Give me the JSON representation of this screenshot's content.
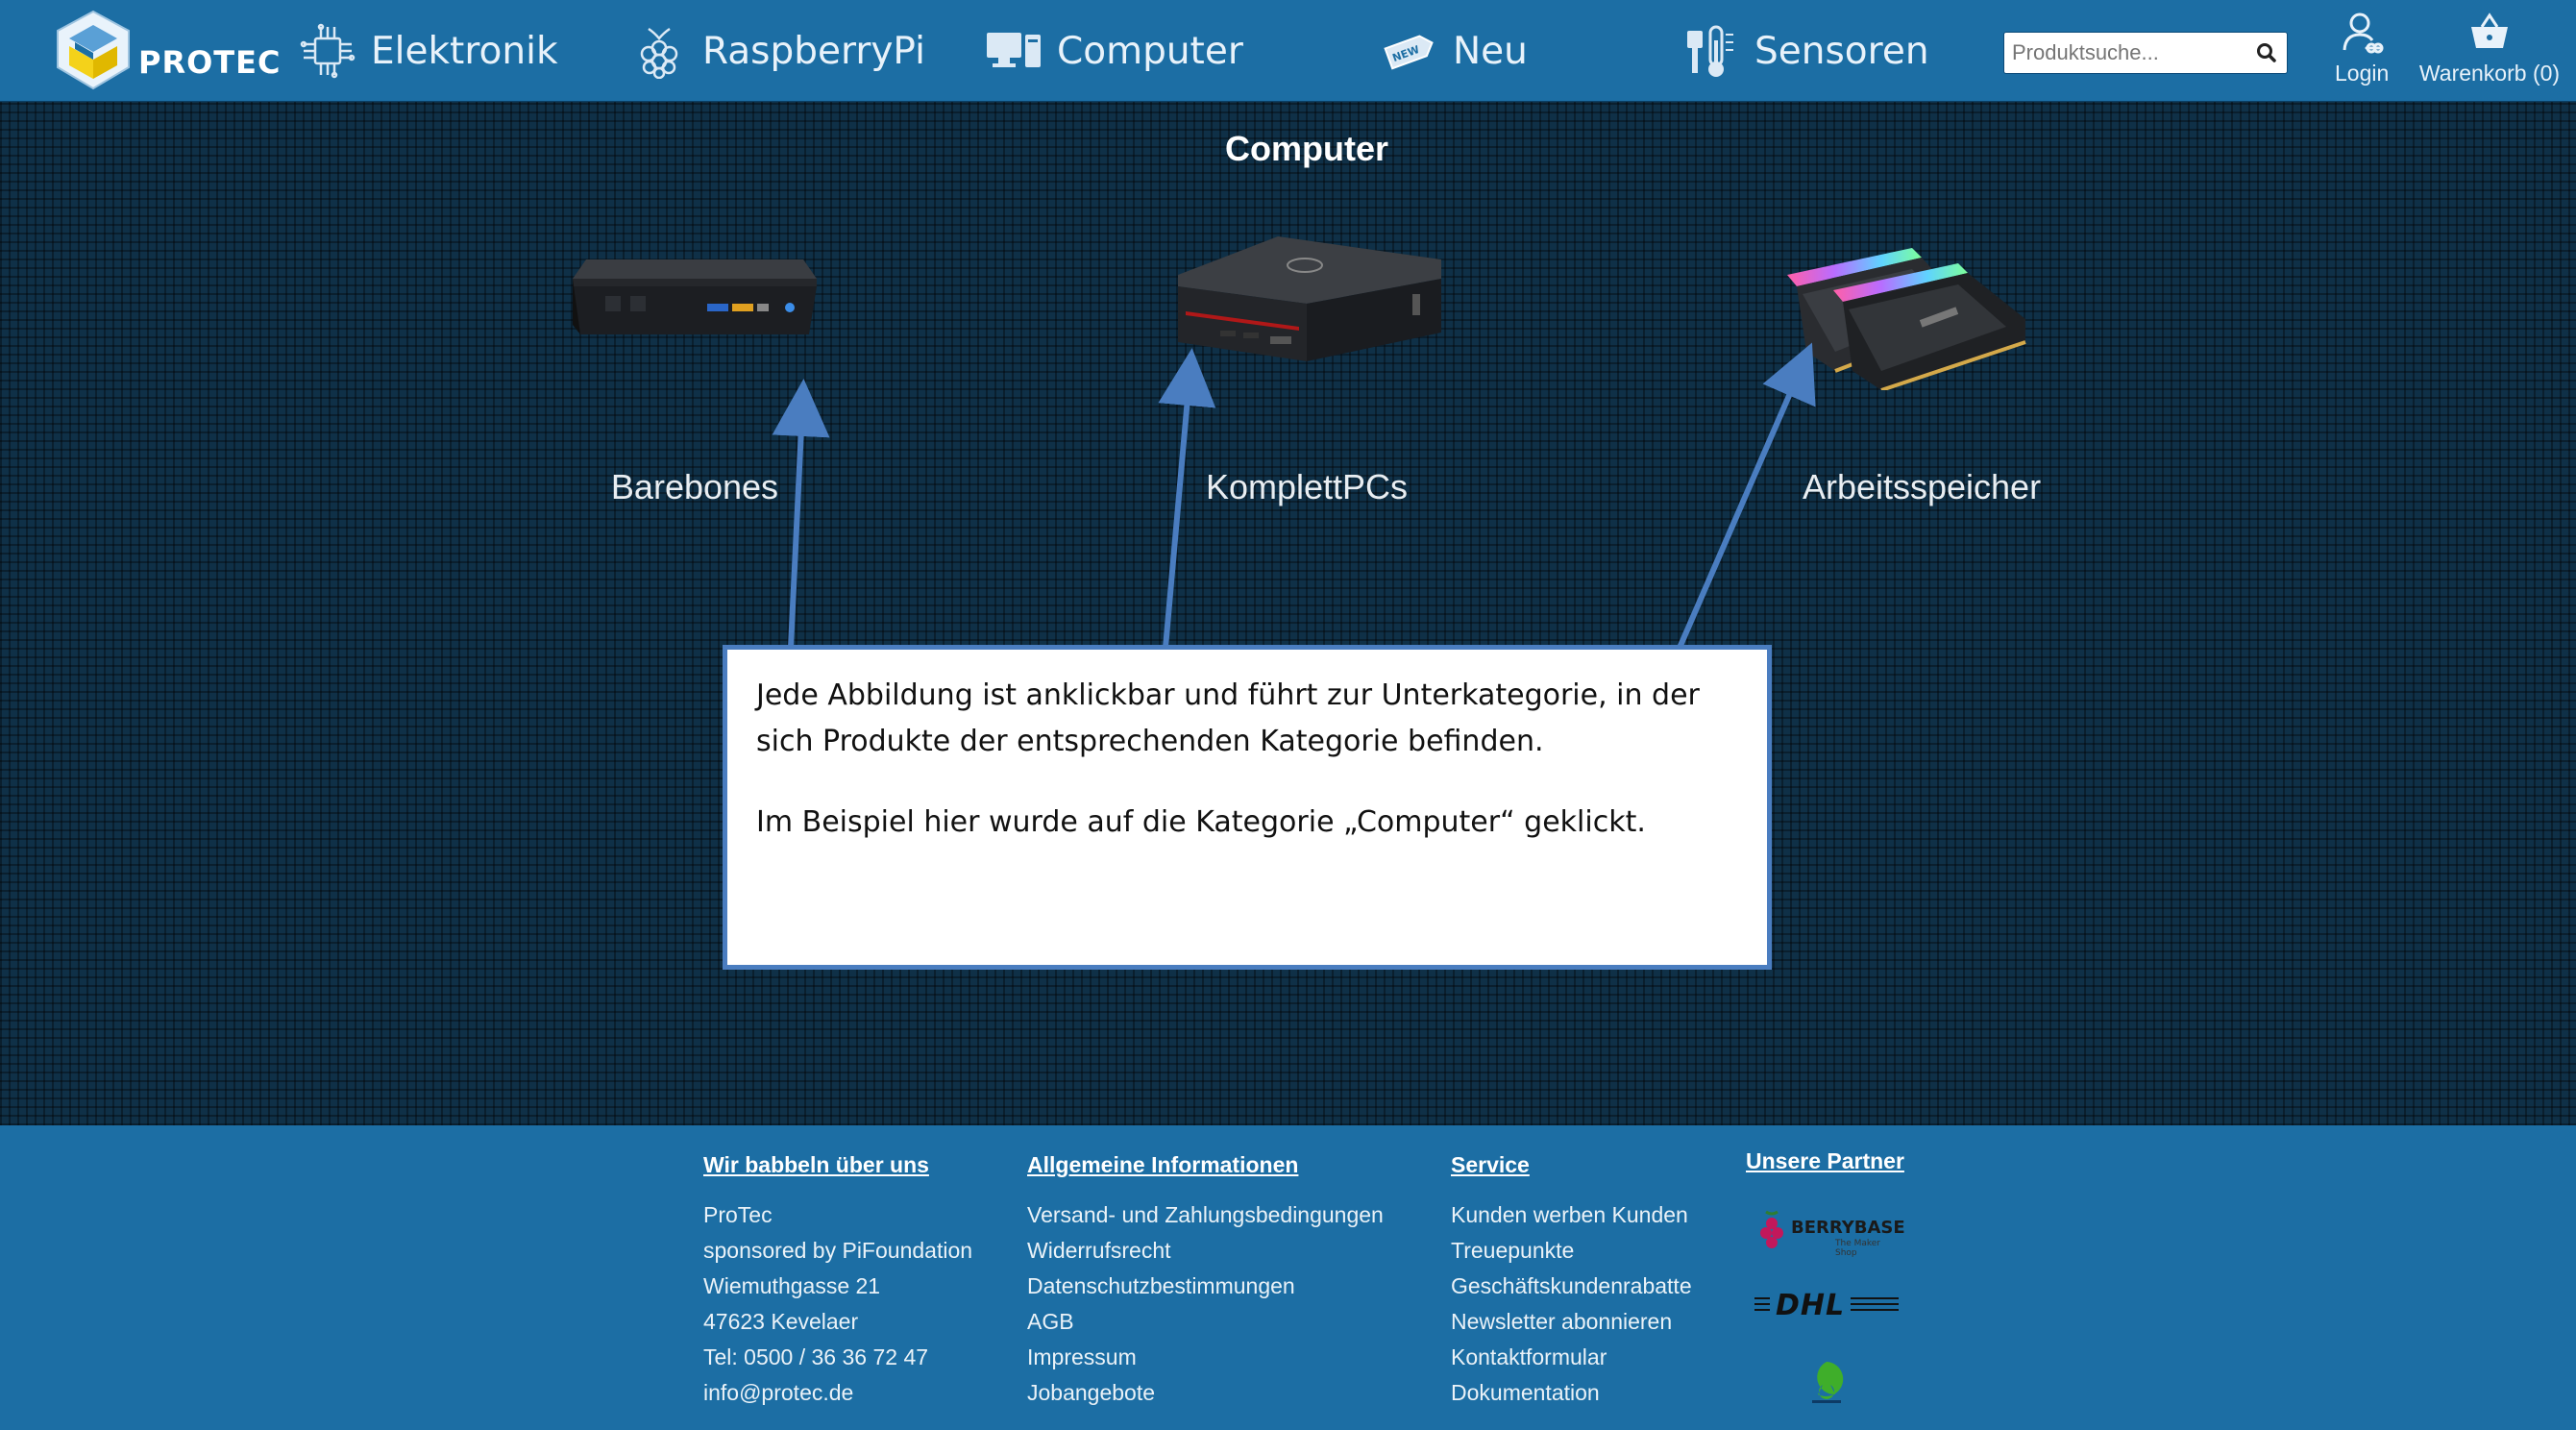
{
  "header": {
    "logo_text": "PROTEC",
    "nav": [
      {
        "label": "Elektronik",
        "icon": "circuit-icon"
      },
      {
        "label": "RaspberryPi",
        "icon": "raspberry-icon"
      },
      {
        "label": "Computer",
        "icon": "monitor-icon"
      },
      {
        "label": "Neu",
        "icon": "new-tag-icon"
      },
      {
        "label": "Sensoren",
        "icon": "sensor-icon"
      }
    ],
    "search": {
      "placeholder": "Produktsuche..."
    },
    "login_label": "Login",
    "cart_label": "Warenkorb (0)"
  },
  "main": {
    "title": "Computer",
    "categories": [
      {
        "label": "Barebones"
      },
      {
        "label": "KomplettPCs"
      },
      {
        "label": "Arbeitsspeicher"
      }
    ],
    "callout": {
      "line1": "Jede Abbildung ist anklickbar und führt zur Unterkategorie, in der sich Produkte der entsprechenden Kategorie befinden.",
      "line2": "Im Beispiel hier wurde auf die Kategorie „Computer“ geklickt."
    }
  },
  "footer": {
    "col1": {
      "heading": "Wir babbeln über uns",
      "lines": [
        "ProTec",
        "sponsored by PiFoundation",
        "Wiemuthgasse 21",
        "47623 Kevelaer",
        "Tel: 0500 / 36 36 72 47",
        "info@protec.de"
      ]
    },
    "col2": {
      "heading": "Allgemeine Informationen",
      "links": [
        "Versand- und Zahlungsbedingungen",
        "Widerrufsrecht",
        "Datenschutzbestimmungen",
        "AGB",
        "Impressum",
        "Jobangebote"
      ]
    },
    "col3": {
      "heading": "Service",
      "links": [
        "Kunden werben Kunden",
        "Treuepunkte",
        "Geschäftskundenrabatte",
        "Newsletter abonnieren",
        "Kontaktformular",
        "Dokumentation"
      ]
    },
    "col4": {
      "heading": "Unsere Partner",
      "partners": [
        "BERRYBASE",
        "The Maker Shop",
        "DHL"
      ]
    }
  },
  "colors": {
    "header_bg": "#1c6ea4",
    "main_bg": "#0f3047",
    "callout_border": "#4a7dc0",
    "arrow": "#4a7dc0"
  }
}
